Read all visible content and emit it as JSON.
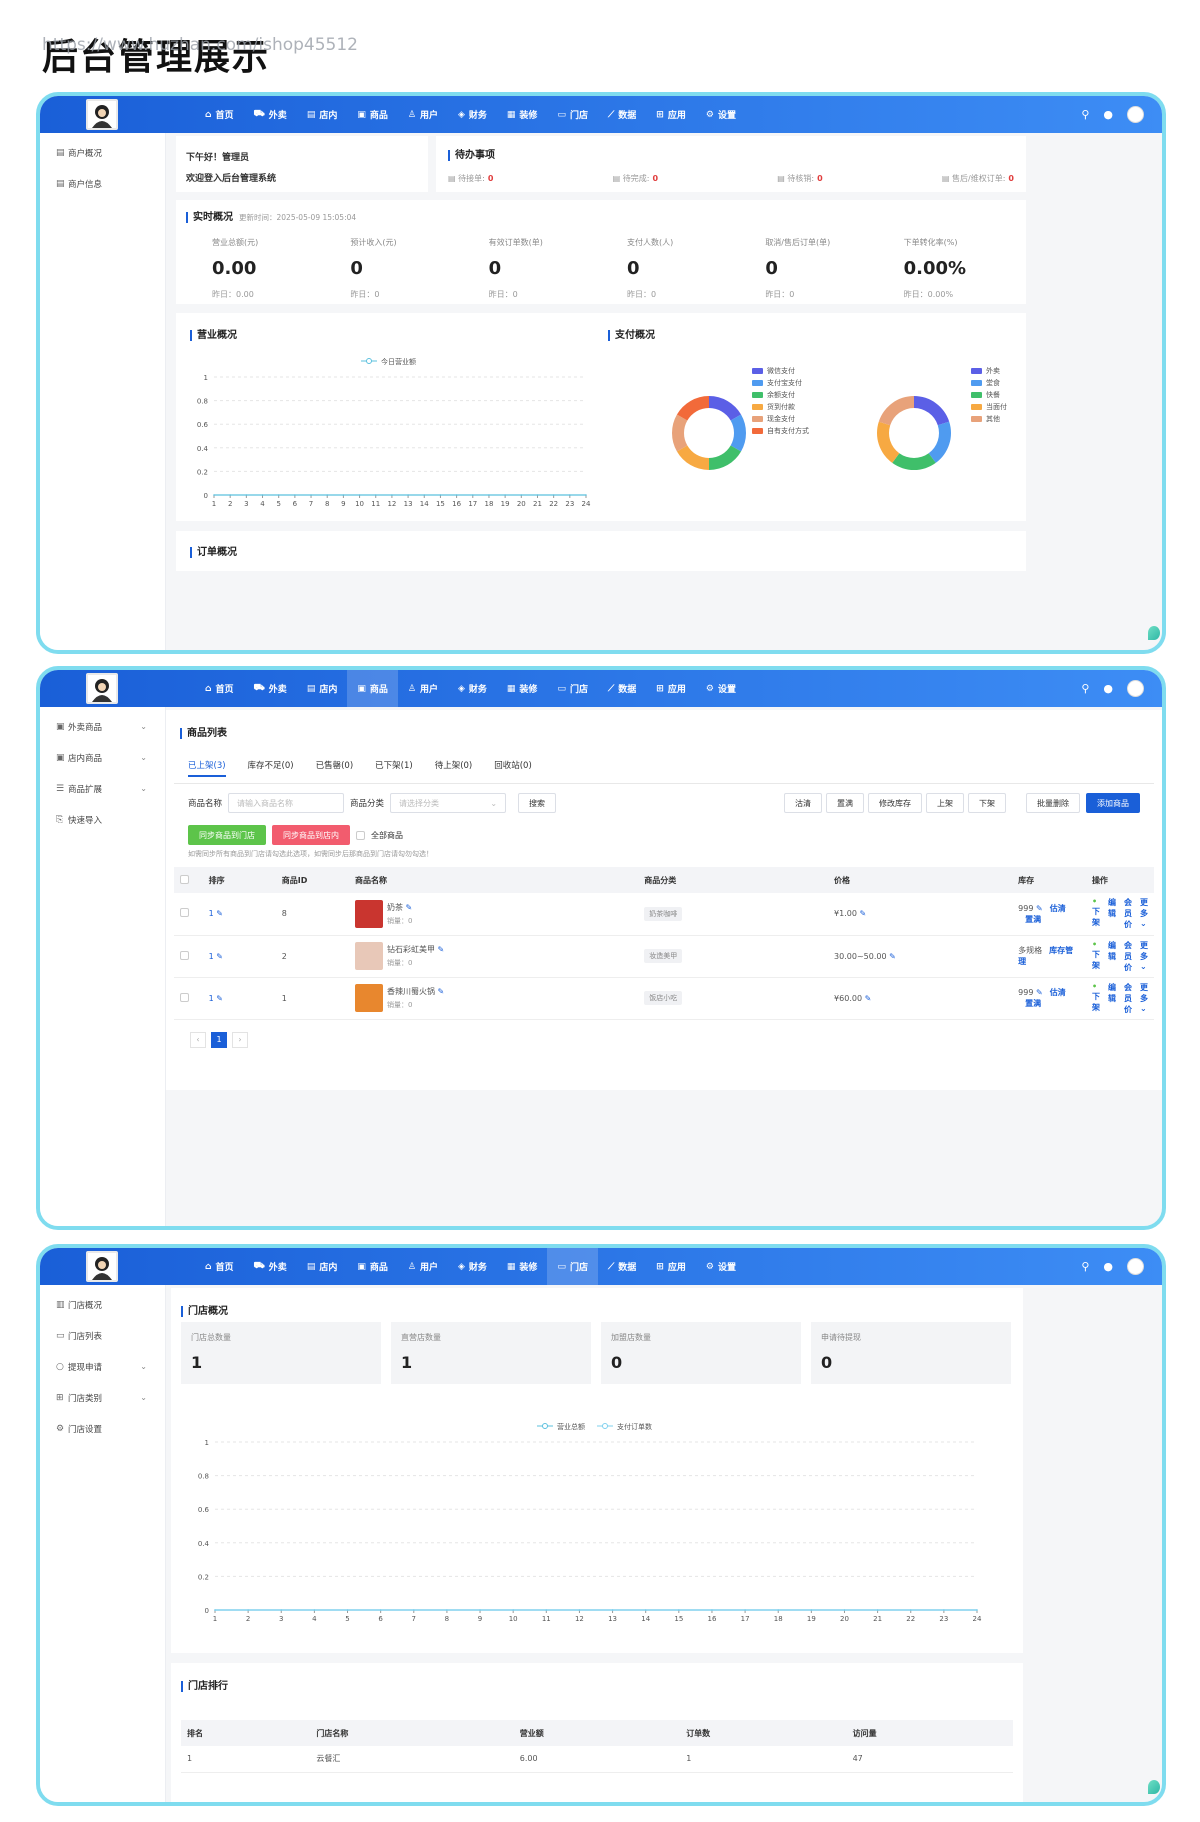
{
  "page_title": "后台管理展示",
  "watermark": "https://www.huzhan.com/ishop45512",
  "nav": [
    {
      "label": "首页",
      "icon": "home-icon",
      "glyph": "⌂"
    },
    {
      "label": "外卖",
      "icon": "scooter-icon",
      "glyph": "⛟"
    },
    {
      "label": "店内",
      "icon": "menu-icon",
      "glyph": "▤"
    },
    {
      "label": "商品",
      "icon": "goods-icon",
      "glyph": "▣"
    },
    {
      "label": "用户",
      "icon": "user-icon",
      "glyph": "♙"
    },
    {
      "label": "财务",
      "icon": "finance-icon",
      "glyph": "◈"
    },
    {
      "label": "装修",
      "icon": "shop-icon",
      "glyph": "▦"
    },
    {
      "label": "门店",
      "icon": "store-icon",
      "glyph": "▭"
    },
    {
      "label": "数据",
      "icon": "chart-icon",
      "glyph": "⟋"
    },
    {
      "label": "应用",
      "icon": "apps-icon",
      "glyph": "⊞"
    },
    {
      "label": "设置",
      "icon": "settings-icon",
      "glyph": "⚙"
    }
  ],
  "topbar_icons": {
    "search": "⚲",
    "bell": "🔔"
  },
  "colors": {
    "primary": "#1a5fd8",
    "frame_border": "#7fdcef"
  },
  "screen1": {
    "sidebar": [
      {
        "label": "商户概况",
        "glyph": "▤"
      },
      {
        "label": "商户信息",
        "glyph": "▤"
      }
    ],
    "welcome": {
      "line1": "下午好！管理员",
      "line2": "欢迎登入后台管理系统"
    },
    "todo": {
      "title": "待办事项",
      "items": [
        {
          "label": "待接单:",
          "value": "0"
        },
        {
          "label": "待完成:",
          "value": "0"
        },
        {
          "label": "待核销:",
          "value": "0"
        },
        {
          "label": "售后/维权订单:",
          "value": "0"
        }
      ]
    },
    "realtime": {
      "title": "实时概况",
      "update_time": "更新时间：2025-05-09 15:05:04",
      "stats": [
        {
          "label": "营业总额(元)",
          "value": "0.00",
          "yesterday": "昨日：0.00"
        },
        {
          "label": "预计收入(元)",
          "value": "0",
          "yesterday": "昨日：0"
        },
        {
          "label": "有效订单数(单)",
          "value": "0",
          "yesterday": "昨日：0"
        },
        {
          "label": "支付人数(人)",
          "value": "0",
          "yesterday": "昨日：0"
        },
        {
          "label": "取消/售后订单(单)",
          "value": "0",
          "yesterday": "昨日：0"
        },
        {
          "label": "下单转化率(%)",
          "value": "0.00%",
          "yesterday": "昨日：0.00%"
        }
      ]
    },
    "business_title": "营业概况",
    "payment_title": "支付概况",
    "order_title": "订单概况",
    "pay_legend_1": [
      {
        "label": "微信支付",
        "color": "#5b5fe6"
      },
      {
        "label": "支付宝支付",
        "color": "#4f9bf0"
      },
      {
        "label": "余额支付",
        "color": "#3fbf6a"
      },
      {
        "label": "货到付款",
        "color": "#f7a942"
      },
      {
        "label": "现金支付",
        "color": "#e8a27a"
      },
      {
        "label": "自有支付方式",
        "color": "#f26a3a"
      }
    ],
    "pay_legend_2": [
      {
        "label": "外卖",
        "color": "#5b5fe6"
      },
      {
        "label": "堂食",
        "color": "#4f9bf0"
      },
      {
        "label": "快餐",
        "color": "#3fbf6a"
      },
      {
        "label": "当面付",
        "color": "#f7a942"
      },
      {
        "label": "其他",
        "color": "#e8a27a"
      }
    ]
  },
  "chart_data": [
    {
      "type": "line",
      "title": "",
      "series": [
        {
          "name": "今日营业额",
          "values": [
            0,
            0,
            0,
            0,
            0,
            0,
            0,
            0,
            0,
            0,
            0,
            0,
            0,
            0,
            0,
            0,
            0,
            0,
            0,
            0,
            0,
            0,
            0,
            0
          ]
        }
      ],
      "x": [
        1,
        2,
        3,
        4,
        5,
        6,
        7,
        8,
        9,
        10,
        11,
        12,
        13,
        14,
        15,
        16,
        17,
        18,
        19,
        20,
        21,
        22,
        23,
        24
      ],
      "yticks": [
        0,
        0.2,
        0.4,
        0.6,
        0.8,
        1
      ],
      "ylim": [
        0,
        1
      ],
      "legend": "top-center",
      "grid": true
    },
    {
      "type": "pie",
      "title": "",
      "labels": [
        "微信支付",
        "支付宝支付",
        "余额支付",
        "货到付款",
        "现金支付",
        "自有支付方式"
      ],
      "values": [
        1,
        1,
        1,
        1,
        1,
        1
      ],
      "donut": true
    },
    {
      "type": "pie",
      "title": "",
      "labels": [
        "外卖",
        "堂食",
        "快餐",
        "当面付",
        "其他"
      ],
      "values": [
        1,
        1,
        1,
        1,
        1
      ],
      "donut": true
    },
    {
      "type": "line",
      "title": "",
      "series": [
        {
          "name": "营业总额",
          "values": [
            0,
            0,
            0,
            0,
            0,
            0,
            0,
            0,
            0,
            0,
            0,
            0,
            0,
            0,
            0,
            0,
            0,
            0,
            0,
            0,
            0,
            0,
            0,
            0
          ]
        },
        {
          "name": "支付订单数",
          "values": [
            0,
            0,
            0,
            0,
            0,
            0,
            0,
            0,
            0,
            0,
            0,
            0,
            0,
            0,
            0,
            0,
            0,
            0,
            0,
            0,
            0,
            0,
            0,
            0
          ]
        }
      ],
      "x": [
        1,
        2,
        3,
        4,
        5,
        6,
        7,
        8,
        9,
        10,
        11,
        12,
        13,
        14,
        15,
        16,
        17,
        18,
        19,
        20,
        21,
        22,
        23,
        24
      ],
      "yticks": [
        0,
        0.2,
        0.4,
        0.6,
        0.8,
        1
      ],
      "ylim": [
        0,
        1
      ],
      "legend": "top-center",
      "grid": true
    }
  ],
  "screen2": {
    "sidebar": [
      {
        "label": "外卖商品",
        "glyph": "▣",
        "chev": "⌄"
      },
      {
        "label": "店内商品",
        "glyph": "▣",
        "chev": "⌄"
      },
      {
        "label": "商品扩展",
        "glyph": "☰",
        "chev": "⌄"
      },
      {
        "label": "快速导入",
        "glyph": "⎘",
        "chev": ""
      }
    ],
    "title": "商品列表",
    "tabs": [
      "已上架(3)",
      "库存不足(0)",
      "已售罄(0)",
      "已下架(1)",
      "待上架(0)",
      "回收站(0)"
    ],
    "filter": {
      "name_label": "商品名称",
      "name_placeholder": "请输入商品名称",
      "cat_label": "商品分类",
      "cat_placeholder": "请选择分类",
      "search": "搜索"
    },
    "actions": [
      "沽清",
      "置满",
      "修改库存",
      "上架",
      "下架"
    ],
    "batch_delete": "批量删除",
    "add": "添加商品",
    "sync_store": "同步商品到门店",
    "sync_inner": "同步商品到店内",
    "all_goods": "全部商品",
    "hint": "如需同步所有商品到门店请勾选此选项，如需同步后那商品到门店请勾勿勾选！",
    "columns": [
      "排序",
      "商品ID",
      "商品名称",
      "商品分类",
      "价格",
      "库存",
      "操作"
    ],
    "rows": [
      {
        "sort": "1",
        "id": "8",
        "name": "奶茶",
        "sales": "销量：0",
        "category": "奶茶咖啡",
        "price": "¥1.00",
        "stock": "999",
        "stock_ops": [
          "估清",
          "置满"
        ],
        "thumb": "#c9352f"
      },
      {
        "sort": "1",
        "id": "2",
        "name": "钻石彩虹美甲",
        "sales": "销量：0",
        "category": "妆造美甲",
        "price": "30.00~50.00",
        "stock": "多规格",
        "stock_ops": [
          "库存管理"
        ],
        "thumb": "#e8c8b8"
      },
      {
        "sort": "1",
        "id": "1",
        "name": "香辣川蜀火锅",
        "sales": "销量：0",
        "category": "饭店小吃",
        "price": "¥60.00",
        "stock": "999",
        "stock_ops": [
          "估清",
          "置满"
        ],
        "thumb": "#e8872e"
      }
    ],
    "row_ops": [
      "下架",
      "编辑",
      "会员价",
      "更多"
    ],
    "page": {
      "prev": "‹",
      "current": "1",
      "next": "›"
    }
  },
  "screen3": {
    "sidebar": [
      {
        "label": "门店概况",
        "glyph": "▥",
        "chev": ""
      },
      {
        "label": "门店列表",
        "glyph": "▭",
        "chev": ""
      },
      {
        "label": "提现申请",
        "glyph": "○",
        "chev": "⌄"
      },
      {
        "label": "门店类别",
        "glyph": "⊞",
        "chev": "⌄"
      },
      {
        "label": "门店设置",
        "glyph": "⚙",
        "chev": ""
      }
    ],
    "title": "门店概况",
    "cards": [
      {
        "label": "门店总数量",
        "value": "1"
      },
      {
        "label": "直营店数量",
        "value": "1"
      },
      {
        "label": "加盟店数量",
        "value": "0"
      },
      {
        "label": "申请待提现",
        "value": "0"
      }
    ],
    "rank_title": "门店排行",
    "rank_columns": [
      "排名",
      "门店名称",
      "营业额",
      "订单数",
      "访问量"
    ],
    "rank_rows": [
      [
        "1",
        "云餐汇",
        "6.00",
        "1",
        "47"
      ]
    ]
  }
}
